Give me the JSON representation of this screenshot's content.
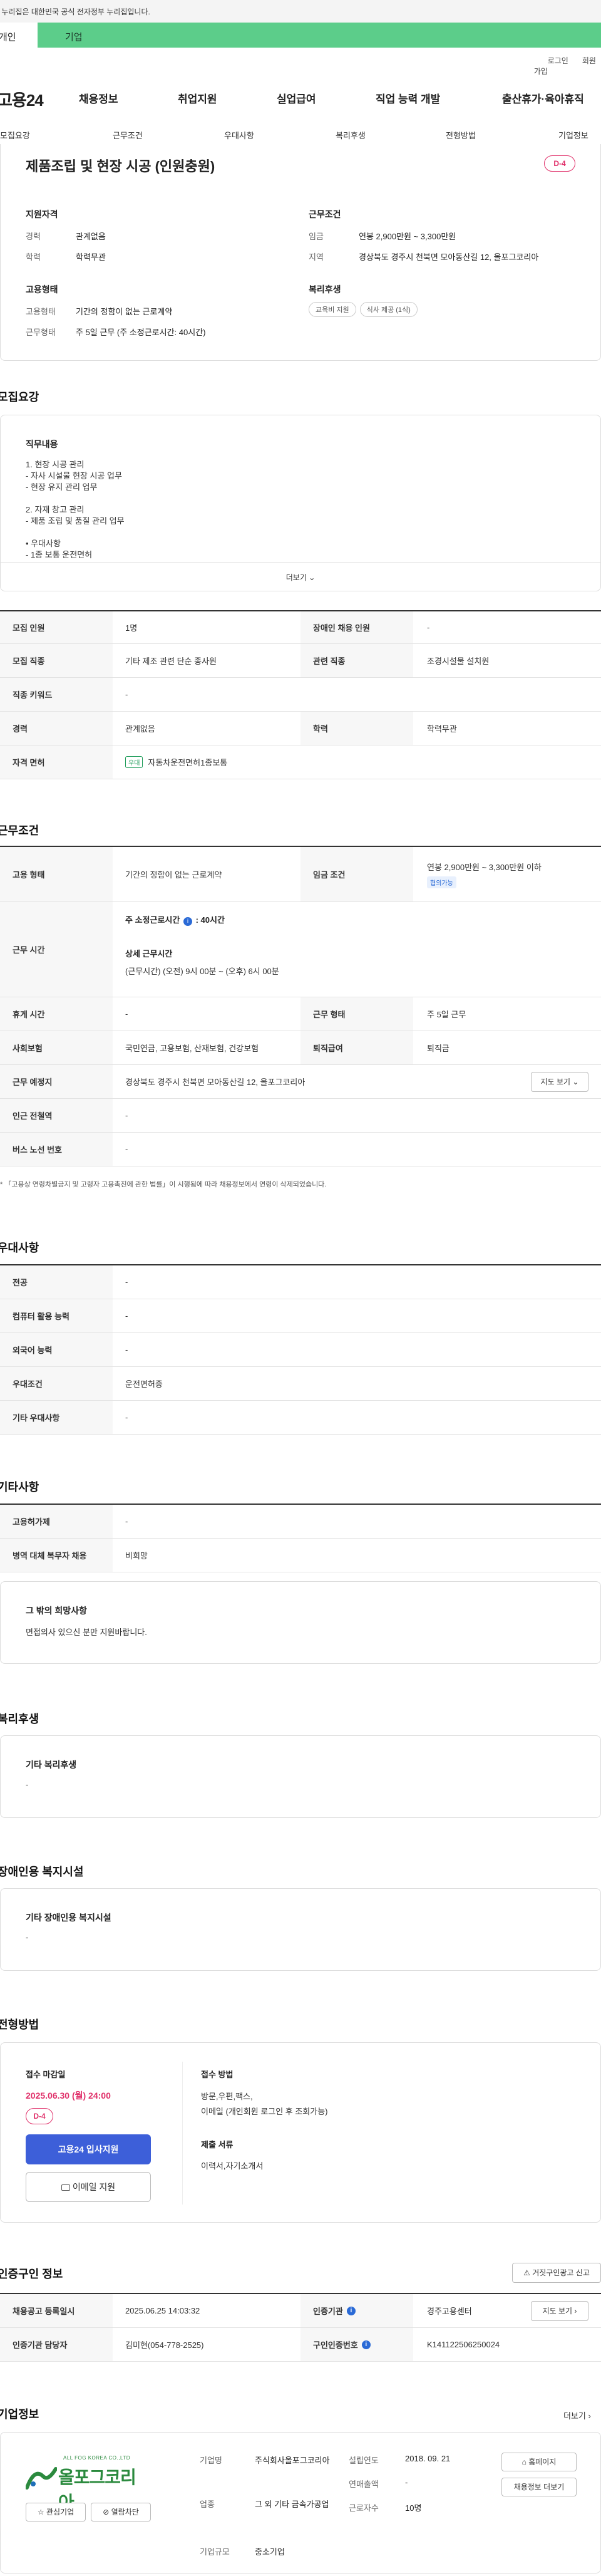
{
  "top_notice": "이 누리집은 대한민국 공식 전자정부 누리집입니다.",
  "audience_tabs": [
    "개인",
    "기업"
  ],
  "util_links": [
    "로그인",
    "회원가입"
  ],
  "site_logo": "고용24",
  "gnb": [
    "채용정보",
    "취업지원",
    "실업급여",
    "직업 능력 개발",
    "출산휴가·육아휴직"
  ],
  "subnav": [
    "모집요강",
    "근무조건",
    "우대사항",
    "복리후생",
    "전형방법",
    "기업정보"
  ],
  "job": {
    "title": "제품조립 및 현장 시공 (인원충원)",
    "dday": "D-4",
    "qual_heading": "지원자격",
    "career_label": "경력",
    "career_value": "관계없음",
    "edu_label": "학력",
    "edu_value": "학력무관",
    "cond_heading": "근무조건",
    "wage_label": "임금",
    "wage_value": "연봉 2,900만원 ~ 3,300만원",
    "region_label": "지역",
    "region_value": "경상북도 경주시 천북면 모아동산길 12, 올포그코리아",
    "emp_heading": "고용형태",
    "emp_type_label": "고용형태",
    "emp_type_value": "기간의 정함이 없는 근로계약",
    "work_type_label": "근무형태",
    "work_type_value": "주 5일 근무 (주 소정근로시간: 40시간)",
    "welfare_heading": "복리후생",
    "welfare_pills": [
      "교육비 지원",
      "식사 제공 (1식)"
    ]
  },
  "recruit": {
    "heading": "모집요강",
    "duty_heading": "직무내용",
    "duty_lines": [
      "1. 현장 시공 관리",
      "- 자사 시설물 현장 시공 업무",
      "- 현장 유지 관리 업무",
      "",
      "2. 자재 창고 관리",
      "- 제품 조립 및 품질 관리 업무",
      "",
      "• 우대사항",
      "- 1종 보통 운전면허"
    ],
    "more": "더보기",
    "rows": [
      {
        "th1": "모집 인원",
        "td1": "1명",
        "th2": "장애인 채용 인원",
        "td2": "-"
      },
      {
        "th1": "모집 직종",
        "td1": "기타 제조 관련 단순 종사원",
        "th2": "관련 직종",
        "td2": "조경시설물 설치원"
      },
      {
        "th1": "직종 키워드",
        "td1": "-"
      },
      {
        "th1": "경력",
        "td1": "관계없음",
        "th2": "학력",
        "td2": "학력무관"
      },
      {
        "th1": "자격 면허",
        "td1": "자동차운전면허1종보통",
        "tag": "우대"
      }
    ]
  },
  "conditions": {
    "heading": "근무조건",
    "emp_label": "고용 형태",
    "emp_value": "기간의 정함이 없는 근로계약",
    "wage_label": "임금 조건",
    "wage_value": "연봉 2,900만원 ~ 3,300만원 이하",
    "wage_badge": "협의가능",
    "hours_label": "근무 시간",
    "hours_weekly": "주 소정근로시간",
    "hours_weekly_value": ": 40시간",
    "hours_detail_heading": "상세 근무시간",
    "hours_detail_value": "(근무시간) (오전) 9시 00분 ~ (오후) 6시 00분",
    "break_label": "휴게 시간",
    "break_value": "-",
    "worktype_label": "근무 형태",
    "worktype_value": "주 5일 근무",
    "insurance_label": "사회보험",
    "insurance_value": "국민연금, 고용보험, 산재보험, 건강보험",
    "severance_label": "퇴직급여",
    "severance_value": "퇴직금",
    "location_label": "근무 예정지",
    "location_value": "경상북도 경주시 천북면 모아동산길 12, 올포그코리아",
    "map_btn": "지도 보기",
    "subway_label": "인근 전철역",
    "subway_value": "-",
    "bus_label": "버스 노선 번호",
    "bus_value": "-",
    "note": "* 「고용상 연령차별금지 및 고령자 고용촉진에 관한 법률」이 시행됨에 따라 채용정보에서 연령이 삭제되었습니다."
  },
  "preference": {
    "heading": "우대사항",
    "rows": [
      {
        "th": "전공",
        "td": "-"
      },
      {
        "th": "컴퓨터 활용 능력",
        "td": "-"
      },
      {
        "th": "외국어 능력",
        "td": "-"
      },
      {
        "th": "우대조건",
        "td": "운전면허증"
      },
      {
        "th": "기타 우대사항",
        "td": "-"
      }
    ]
  },
  "other": {
    "heading": "기타사항",
    "rows": [
      {
        "th": "고용허가제",
        "td": "-"
      },
      {
        "th": "병역 대체 복무자 채용",
        "td": "비희망"
      }
    ],
    "box_heading": "그 밖의 희망사항",
    "box_text": "면접의사 있으신 분만 지원바랍니다."
  },
  "welfare": {
    "heading": "복리후생",
    "box_heading": "기타 복리후생",
    "box_text": "-"
  },
  "disability": {
    "heading": "장애인용 복지시설",
    "box_heading": "기타 장애인용 복지시설",
    "box_text": "-"
  },
  "selection": {
    "heading": "전형방법",
    "deadline_label": "접수 마감일",
    "deadline_value": "2025.06.30 (월) 24:00",
    "dday": "D-4",
    "apply_btn": "고용24 입사지원",
    "email_btn": "이메일 지원",
    "method_heading": "접수 방법",
    "method_lines": [
      "방문,우편,팩스,",
      "이메일 (개인회원 로그인 후 조회가능)"
    ],
    "docs_heading": "제출 서류",
    "docs_value": "이력서,자기소개서"
  },
  "certification": {
    "heading": "인증구인 정보",
    "report_btn": "거짓구인광고 신고",
    "rows": [
      {
        "th1": "채용공고 등록일시",
        "td1": "2025.06.25 14:03:32",
        "th2": "인증기관",
        "td2": "경주고용센터",
        "btn": "지도 보기"
      },
      {
        "th1": "인증기관 담당자",
        "td1": "김미현(054-778-2525)",
        "th2": "구인인증번호",
        "td2": "K141122506250024"
      }
    ]
  },
  "company": {
    "heading": "기업정보",
    "more": "더보기",
    "logo_text": "올포그코리아",
    "logo_sub": "ALL FOG KOREA CO.,LTD",
    "fav_btn": "관심기업",
    "block_btn": "열람차단",
    "name_label": "기업명",
    "name_value": "주식회사올포그코리아",
    "industry_label": "업종",
    "industry_value": "그 외 기타 금속가공업",
    "size_label": "기업규모",
    "size_value": "중소기업",
    "founded_label": "설립연도",
    "founded_value": "2018. 09. 21",
    "revenue_label": "연매출액",
    "revenue_value": "-",
    "staff_label": "근로자수",
    "staff_value": "10명",
    "homepage_btn": "홈페이지",
    "jobs_btn": "채용정보 더보기"
  }
}
